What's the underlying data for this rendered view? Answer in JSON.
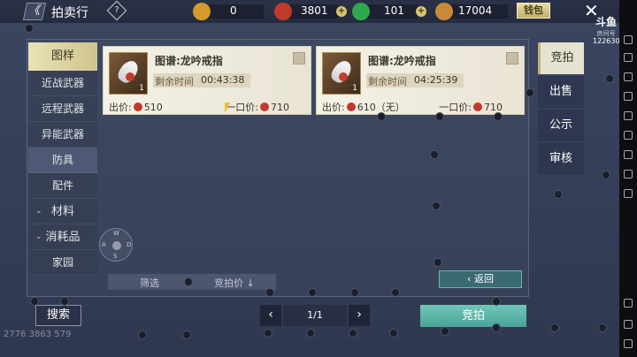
{
  "header": {
    "title": "拍卖行",
    "back_label": "《",
    "help_label": "?",
    "wallet_label": "钱包",
    "close_label": "✕"
  },
  "resources": [
    {
      "name": "gold-token",
      "value": "0",
      "color": "#d49a2a"
    },
    {
      "name": "red-coin",
      "value": "3801",
      "color": "#c0392b"
    },
    {
      "name": "jade",
      "value": "101",
      "color": "#2fa84f"
    },
    {
      "name": "feather",
      "value": "17004",
      "color": "#c98b3a"
    }
  ],
  "watermark": {
    "logo": "斗鱼",
    "room_label": "房间号",
    "room_id": "1226307"
  },
  "categories": [
    {
      "label": "图样",
      "type": "head"
    },
    {
      "label": "近战武器",
      "type": "sub"
    },
    {
      "label": "远程武器",
      "type": "sub"
    },
    {
      "label": "异能武器",
      "type": "sub"
    },
    {
      "label": "防具",
      "type": "sub",
      "selected": true
    },
    {
      "label": "配件",
      "type": "sub"
    },
    {
      "label": "材料",
      "type": "group"
    },
    {
      "label": "消耗品",
      "type": "group"
    },
    {
      "label": "家园",
      "type": "sub"
    }
  ],
  "listings": [
    {
      "name": "图谱:龙吟戒指",
      "count": "1",
      "time_label": "剩余时间",
      "time": "00:43:38",
      "bid_label": "出价:",
      "bid": "510",
      "buyout_label": "一口价:",
      "buyout": "710"
    },
    {
      "name": "图谱:龙吟戒指",
      "count": "1",
      "time_label": "剩余时间",
      "time": "04:25:39",
      "bid_label": "出价:",
      "bid": "610（无）",
      "buyout_label": "一口价:",
      "buyout": "710"
    }
  ],
  "right_tabs": [
    {
      "label": "竞拍",
      "selected": true
    },
    {
      "label": "出售"
    },
    {
      "label": "公示"
    },
    {
      "label": "审核"
    }
  ],
  "filter": {
    "filter_label": "筛选",
    "sort_label": "竞拍价 ↓"
  },
  "buttons": {
    "return_label": "返回",
    "search_label": "搜索",
    "bid_label": "竞拍"
  },
  "pager": {
    "prev": "‹",
    "next": "›",
    "text": "1/1"
  },
  "joystick": {
    "up": "W",
    "left": "A",
    "right": "D",
    "down": "S"
  },
  "overlay": {
    "numbers": "2776  3863  579"
  }
}
